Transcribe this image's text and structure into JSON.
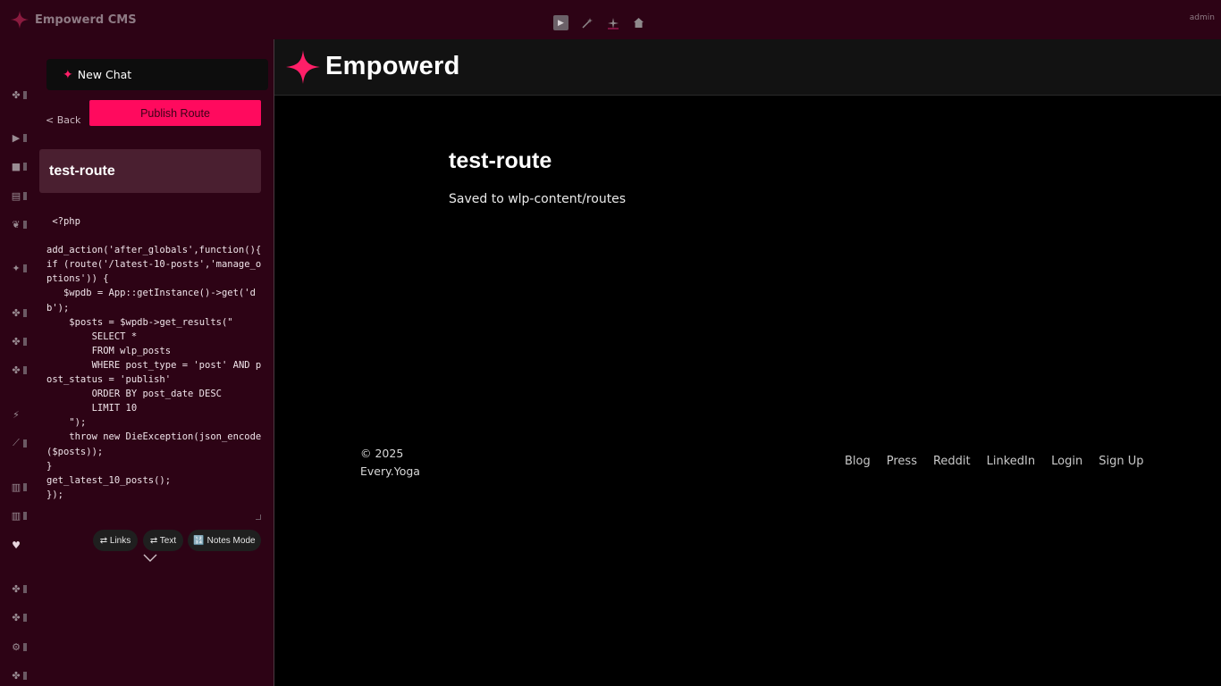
{
  "app": {
    "title": "Empowerd CMS",
    "user": "admin",
    "toolbar_icons": [
      "play-icon",
      "magic-wand-icon",
      "sparkle-icon",
      "home-icon"
    ]
  },
  "rail": {
    "icons": [
      "puzzle-icon",
      "play-icon",
      "folder-icon",
      "document-icon",
      "brain-icon",
      "sparkle-icon",
      "puzzle-icon",
      "puzzle-icon",
      "puzzle-icon",
      "plug-icon",
      "magic-wand-icon",
      "list-icon",
      "list-icon",
      "heart-icon",
      "puzzle-icon",
      "puzzle-icon",
      "gear-icon",
      "puzzle-icon"
    ]
  },
  "sidebar": {
    "new_chat_label": "New Chat",
    "back_label": "< Back",
    "publish_label": "Publish Route",
    "route_name": "test-route",
    "code": " <?php\n\nadd_action('after_globals',function(){\nif (route('/latest-10-posts','manage_options')) {\n   $wpdb = App::getInstance()->get('db');\n    $posts = $wpdb->get_results(\"\n        SELECT *\n        FROM wlp_posts\n        WHERE post_type = 'post' AND post_status = 'publish'\n        ORDER BY post_date DESC\n        LIMIT 10\n    \");\n    throw new DieException(json_encode($posts));\n}\nget_latest_10_posts();\n});",
    "chips": {
      "links": "⇄ Links",
      "text": "⇄ Text",
      "notes": "🔢 Notes Mode"
    }
  },
  "preview": {
    "brand": "Empowerd",
    "page_title": "test-route",
    "page_subtitle": "Saved to wlp-content/routes",
    "copyright_line1": "© 2025",
    "copyright_line2": "Every.Yoga",
    "footer_links": [
      "Blog",
      "Press",
      "Reddit",
      "LinkedIn",
      "Login",
      "Sign Up"
    ]
  },
  "colors": {
    "accent": "#ff0a5e",
    "sidebar_bg": "#2d0315",
    "route_card_bg": "#4a1f30",
    "preview_bg": "#000000"
  }
}
